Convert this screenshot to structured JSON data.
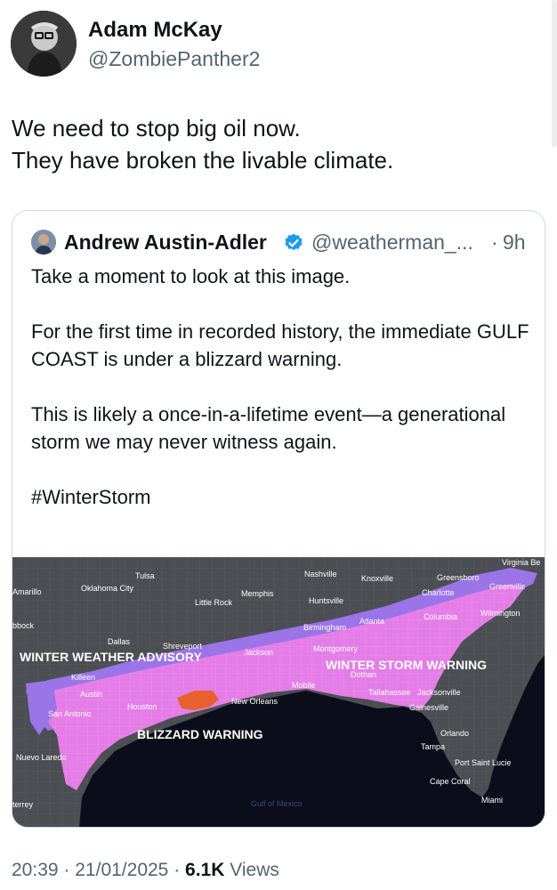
{
  "author": {
    "name": "Adam McKay",
    "handle": "@ZombiePanther2"
  },
  "tweet": {
    "lines": [
      "We need to stop big oil now.",
      "They have broken the livable climate."
    ]
  },
  "quote": {
    "name": "Andrew Austin-Adler",
    "handle": "@weatherman_...",
    "separator": "·",
    "time": "9h",
    "paragraphs": [
      "Take a moment to look at this image.",
      "For the first time in recorded history, the immediate GULF COAST is under a blizzard warning.",
      "This is likely a once-in-a-lifetime event—a generational storm we may never witness again.",
      "#WinterStorm"
    ]
  },
  "map": {
    "labels": {
      "advisory": "WINTER WEATHER ADVISORY",
      "storm_warning": "WINTER STORM WARNING",
      "blizzard": "BLIZZARD WARNING",
      "gulf": "Gulf of Mexico"
    },
    "cities": {
      "tulsa": "Tulsa",
      "oklahoma_city": "Oklahoma City",
      "amarillo": "Amarillo",
      "lubbock": "bbock",
      "little_rock": "Little Rock",
      "memphis": "Memphis",
      "nashville": "Nashville",
      "knoxville": "Knoxville",
      "greensboro": "Greensboro",
      "virginia_beach": "Virginia Be",
      "greenville": "Greenville",
      "charlotte": "Charlotte",
      "huntsville": "Huntsville",
      "wilmington": "Wilmington",
      "columbia": "Columbia",
      "atlanta": "Atlanta",
      "birmingham": "Birmingham",
      "dallas": "Dallas",
      "shreveport": "Shreveport",
      "jackson": "Jackson",
      "montgomery": "Montgomery",
      "dothan": "Dothan",
      "killeen": "Killeen",
      "mobile": "Mobile",
      "austin": "Austin",
      "tallahassee": "Tallahassee",
      "jacksonville": "Jacksonville",
      "houston": "Houston",
      "new_orleans": "New Orleans",
      "gainesville": "Gainesville",
      "san_antonio": "San Antonio",
      "orlando": "Orlando",
      "tampa": "Tampa",
      "nuevo_laredo": "Nuevo Laredo",
      "port_st_lucie": "Port Saint Lucie",
      "cape_coral": "Cape Coral",
      "miami": "Miami",
      "monterrey": "terrey"
    },
    "colors": {
      "land": "#4b4e53",
      "water": "#0c0d1a",
      "advisory": "#9b74e8",
      "storm_warning": "#e47de7",
      "blizzard": "#e8612c"
    }
  },
  "meta": {
    "time": "20:39",
    "sep": "·",
    "date": "21/01/2025",
    "views_count": "6.1K",
    "views_label": "Views"
  }
}
